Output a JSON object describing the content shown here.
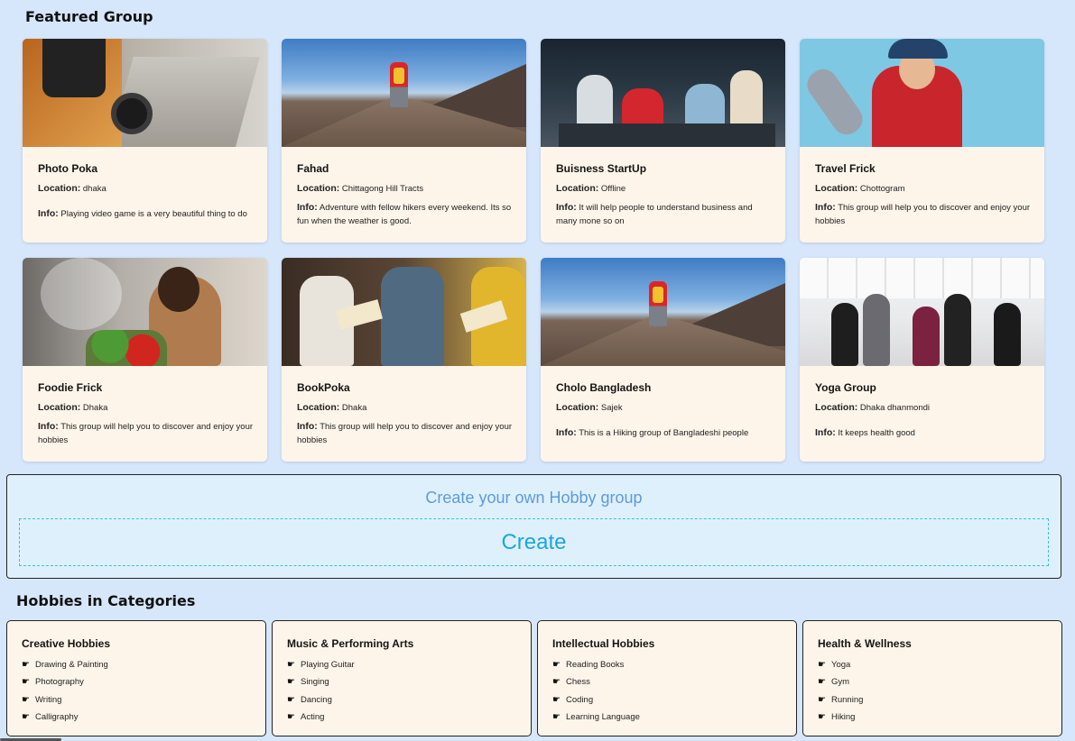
{
  "featured": {
    "title": "Featured Group",
    "location_label": "Location:",
    "info_label": "Info:",
    "groups": [
      {
        "name": "Photo Poka",
        "location": "dhaka",
        "info": "Playing video game is a very beautiful thing to do",
        "image": "photo-traveler-with-camera"
      },
      {
        "name": "Fahad",
        "location": "Chittagong Hill Tracts",
        "info": "Adventure with fellow hikers every weekend. Its so fun when the weather is good.",
        "image": "mountain-hiker"
      },
      {
        "name": "Buisness StartUp",
        "location": "Offline",
        "info": "It will help people to understand business and many mone so on",
        "image": "business-meeting"
      },
      {
        "name": "Travel Frick",
        "location": "Chottogram",
        "info": "This group will help you to discover and enjoy your hobbies",
        "image": "traveler-with-binoculars"
      },
      {
        "name": "Foodie Frick",
        "location": "Dhaka",
        "info": "This group will help you to discover and enjoy your hobbies",
        "image": "woman-cooking"
      },
      {
        "name": "BookPoka",
        "location": "Dhaka",
        "info": "This group will help you to discover and enjoy your hobbies",
        "image": "people-reading-books"
      },
      {
        "name": "Cholo Bangladesh",
        "location": "Sajek",
        "info": "This is a Hiking group of Bangladeshi people",
        "image": "mountain-hiker"
      },
      {
        "name": "Yoga Group",
        "location": "Dhaka dhanmondi",
        "info": "It keeps health good",
        "image": "yoga-class"
      }
    ]
  },
  "create": {
    "heading": "Create your own Hobby group",
    "button_label": "Create"
  },
  "categories": {
    "title": "Hobbies in Categories",
    "bullet_icon": "pointing-hand-icon",
    "items": [
      {
        "title": "Creative Hobbies",
        "hobbies": [
          "Drawing & Painting",
          "Photography",
          "Writing",
          "Calligraphy"
        ]
      },
      {
        "title": "Music & Performing Arts",
        "hobbies": [
          "Playing Guitar",
          "Singing",
          "Dancing",
          "Acting"
        ]
      },
      {
        "title": "Intellectual Hobbies",
        "hobbies": [
          "Reading Books",
          "Chess",
          "Coding",
          "Learning Language"
        ]
      },
      {
        "title": "Health & Wellness",
        "hobbies": [
          "Yoga",
          "Gym",
          "Running",
          "Hiking"
        ]
      }
    ]
  },
  "colors": {
    "page_background": "#d6e6fb",
    "card_background": "#fdf5ea",
    "create_heading": "#5d9bdc",
    "create_button_text": "#1aa6e0",
    "create_button_border": "#3fc1c9"
  }
}
